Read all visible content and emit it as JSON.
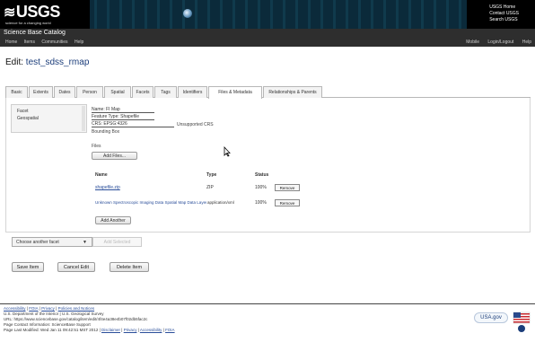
{
  "header": {
    "logo_text": "USGS",
    "tagline": "science for a changing world",
    "links": [
      "USGS Home",
      "Contact USGS",
      "Search USGS"
    ]
  },
  "titlebar": {
    "title": "Science Base Catalog",
    "nav_left": [
      "Home",
      "Items",
      "Communities",
      "Help"
    ],
    "nav_right": [
      "Mobile",
      "Login/Logout",
      "Help"
    ]
  },
  "edit": {
    "prefix": "Edit:",
    "name": "test_sdss_rmap"
  },
  "tabs": [
    "Basic",
    "Extents",
    "Dates",
    "Person",
    "Spatial",
    "Facets",
    "Tags",
    "Identifiers",
    "Files & Metadata",
    "Relationships & Parents"
  ],
  "sidebar": {
    "items": [
      "Facet",
      "Geospatial"
    ]
  },
  "form": {
    "field1": "Name: FI Map",
    "field2": "Feature Type: Shapefile",
    "field3": "CRS: EPSG:4326",
    "field3_extra": "Unsupported CRS",
    "field4": "Bounding Box",
    "files_label": "Files",
    "add_files_button": "Add Files...",
    "table_headers": [
      "Name",
      "Type",
      "Status"
    ],
    "files": [
      {
        "name": "shapefile.zip",
        "type": "ZIP",
        "status": "100%",
        "action": "Remove"
      },
      {
        "name": "Unknown Spectroscopic Imaging Data Spatial Map Data Layer",
        "type": "application/xml",
        "status": "100%",
        "action": "Remove"
      }
    ],
    "add_more_button": "Add Another"
  },
  "bottom": {
    "select_value": "Choose another facet",
    "add_selected": "Add Selected",
    "buttons": [
      "Save Item",
      "Cancel Edit",
      "Delete Item"
    ]
  },
  "footer": {
    "links_row": [
      "Accessibility",
      "FOIA",
      "Privacy",
      "Policies and Notices"
    ],
    "line2": "U.S. Department of the Interior | U.S. Geological Survey",
    "line3": "URL: https://www.sciencebase.gov/catalog/item/edit/4f4e4a38e4b07f02db5fac2c",
    "line4": "Page Contact Information: ScienceBase Support",
    "line5_text": "Page Last Modified: Wed Jan 11 09:42:51 MST 2012",
    "line5_links": [
      "Disclaimer",
      "Privacy",
      "Accessibility",
      "FOIA"
    ],
    "usagov": "USA.gov"
  },
  "colors": {
    "header_bg": "#000000",
    "link": "#2a4e9a",
    "heading_name": "#1b3d7a"
  }
}
